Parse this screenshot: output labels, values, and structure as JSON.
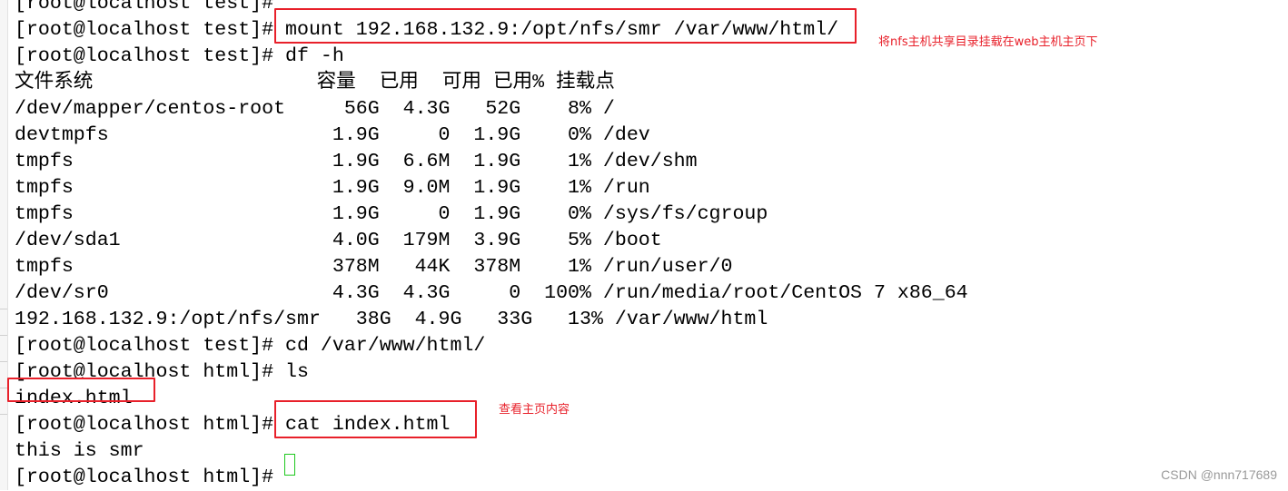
{
  "terminal": {
    "lines": [
      "[root@localhost test]# ",
      "[root@localhost test]# mount 192.168.132.9:/opt/nfs/smr /var/www/html/",
      "[root@localhost test]# df -h",
      "文件系统                   容量  已用  可用 已用% 挂载点",
      "/dev/mapper/centos-root     56G  4.3G   52G    8% /",
      "devtmpfs                   1.9G     0  1.9G    0% /dev",
      "tmpfs                      1.9G  6.6M  1.9G    1% /dev/shm",
      "tmpfs                      1.9G  9.0M  1.9G    1% /run",
      "tmpfs                      1.9G     0  1.9G    0% /sys/fs/cgroup",
      "/dev/sda1                  4.0G  179M  3.9G    5% /boot",
      "tmpfs                      378M   44K  378M    1% /run/user/0",
      "/dev/sr0                   4.3G  4.3G     0  100% /run/media/root/CentOS 7 x86_64",
      "192.168.132.9:/opt/nfs/smr   38G  4.9G   33G   13% /var/www/html",
      "[root@localhost test]# cd /var/www/html/",
      "[root@localhost html]# ls",
      "index.html",
      "[root@localhost html]# cat index.html",
      "this is smr",
      "[root@localhost html]# "
    ]
  },
  "annotations": {
    "mount_note": "将nfs主机共享目录挂载在web主机主页下",
    "cat_note": "查看主页内容"
  },
  "watermark": "CSDN @nnn717689",
  "colors": {
    "annotation_red": "#e8202a",
    "cursor_green": "#1ec81e"
  }
}
